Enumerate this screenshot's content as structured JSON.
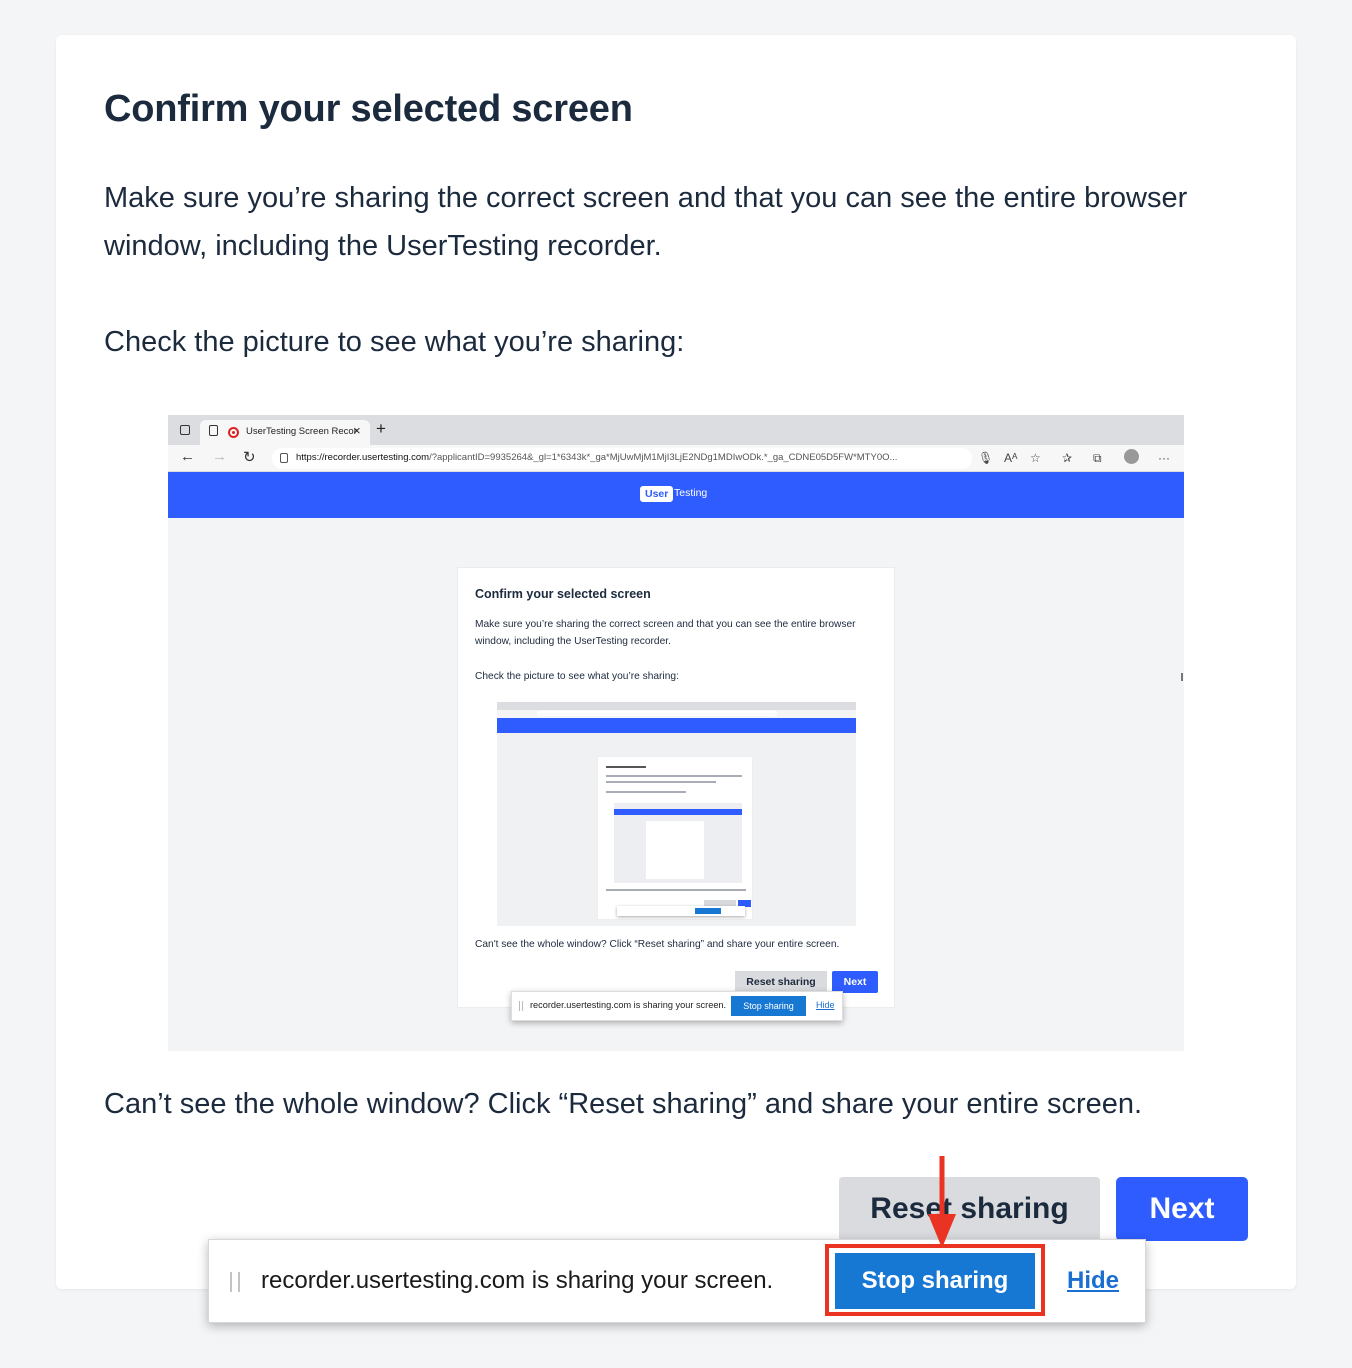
{
  "page": {
    "title": "Confirm your selected screen",
    "paragraph1": "Make sure you’re sharing the correct screen and that you can see the entire browser window, including the UserTesting recorder.",
    "paragraph2": "Check the picture to see what you’re sharing:",
    "paragraph3": "Can’t see the whole window? Click “Reset sharing” and share your entire screen."
  },
  "preview": {
    "tab_label": "UserTesting Screen Recor",
    "url_domain": "https://recorder.usertesting.com",
    "url_rest": "/?applicantID=9935264&_gl=1*6343k*_ga*MjUwMjM1MjI3LjE2NDg1MDIwODk.*_ga_CDNE05D5FW*MTY0O...",
    "logo_user": "User",
    "logo_testing": "Testing",
    "inner_title": "Confirm your selected screen",
    "inner_paragraph1": "Make sure you’re sharing the correct screen and that you can see the entire browser window, including the UserTesting recorder.",
    "inner_paragraph2": "Check the picture to see what you’re sharing:",
    "inner_paragraph3": "Can't see the whole window? Click “Reset sharing” and share your entire screen.",
    "inner_reset": "Reset sharing",
    "inner_next": "Next",
    "inner_share_text": "recorder.usertesting.com is sharing your screen.",
    "inner_stop": "Stop sharing",
    "inner_hide": "Hide"
  },
  "actions": {
    "reset_label": "Reset sharing",
    "next_label": "Next"
  },
  "sharebar": {
    "text": "recorder.usertesting.com is sharing your screen.",
    "stop_label": "Stop sharing",
    "hide_label": "Hide"
  },
  "colors": {
    "primary_blue": "#2e5cff",
    "stop_blue": "#1778d4",
    "highlight_red": "#ea3323",
    "text_dark": "#1c2a3e"
  }
}
